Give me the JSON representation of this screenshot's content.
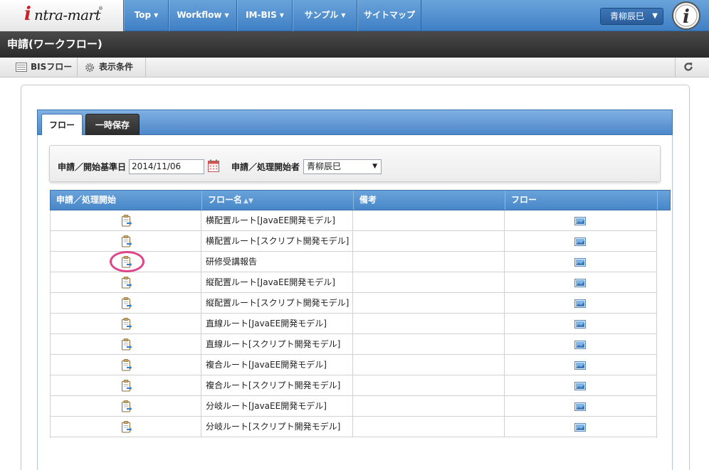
{
  "nav": {
    "logo": {
      "mark": "i",
      "text": "ntra-mart",
      "reg": "®"
    },
    "items": [
      {
        "label": "Top"
      },
      {
        "label": "Workflow"
      },
      {
        "label": "IM-BIS"
      },
      {
        "label": "サンプル"
      },
      {
        "label": "サイトマップ"
      }
    ],
    "user": "青柳辰巳",
    "info_icon": "info-i-icon"
  },
  "page_title": "申請(ワークフロー)",
  "toolbar": {
    "bis_flow": "BISフロー",
    "display_conditions": "表示条件",
    "refresh_icon": "refresh-icon"
  },
  "tabs": [
    {
      "label": "フロー",
      "active": true
    },
    {
      "label": "一時保存",
      "active": false
    }
  ],
  "filter": {
    "date_label": "申請／開始基準日",
    "date_value": "2014/11/06",
    "applicant_label": "申請／処理開始者",
    "applicant_value": "青柳辰巳"
  },
  "table": {
    "headers": [
      "申請／処理開始",
      "フロー名",
      "備考",
      "フロー"
    ],
    "rows": [
      {
        "name": "横配置ルート[JavaEE開発モデル]",
        "note": ""
      },
      {
        "name": "横配置ルート[スクリプト開発モデル]",
        "note": ""
      },
      {
        "name": "研修受講報告",
        "note": ""
      },
      {
        "name": "縦配置ルート[JavaEE開発モデル]",
        "note": ""
      },
      {
        "name": "縦配置ルート[スクリプト開発モデル]",
        "note": ""
      },
      {
        "name": "直線ルート[JavaEE開発モデル]",
        "note": ""
      },
      {
        "name": "直線ルート[スクリプト開発モデル]",
        "note": ""
      },
      {
        "name": "複合ルート[JavaEE開発モデル]",
        "note": ""
      },
      {
        "name": "複合ルート[スクリプト開発モデル]",
        "note": ""
      },
      {
        "name": "分岐ルート[JavaEE開発モデル]",
        "note": ""
      },
      {
        "name": "分岐ルート[スクリプト開発モデル]",
        "note": ""
      }
    ],
    "highlighted_row": 2
  },
  "colors": {
    "nav_blue": "#4786c8",
    "title_dark": "#2b2b2b",
    "highlight": "#e0458a"
  }
}
